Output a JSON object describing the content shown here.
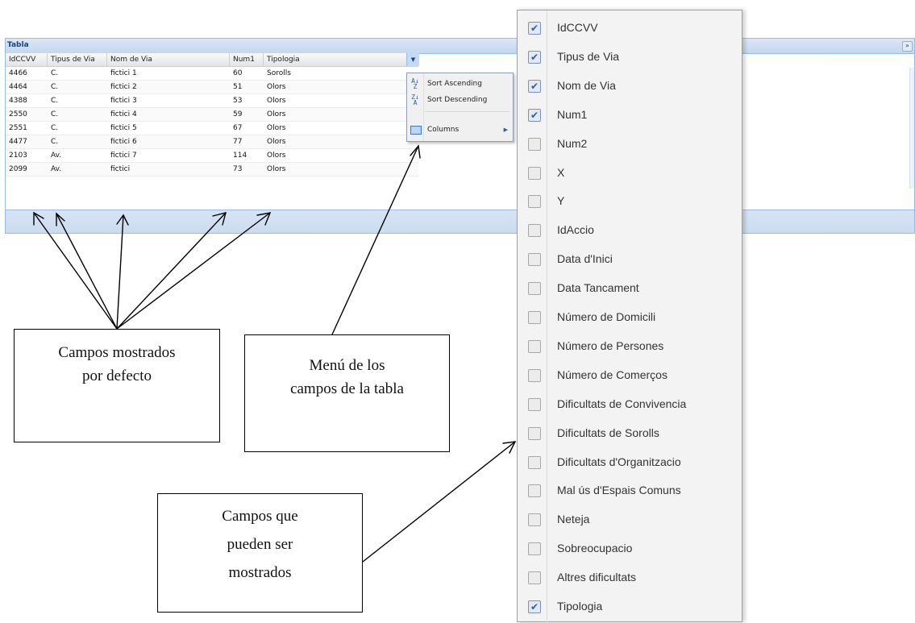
{
  "panel": {
    "title": "Tabla"
  },
  "grid": {
    "columns": [
      "IdCCVV",
      "Tipus de Via",
      "Nom de Via",
      "Num1",
      "Tipologia"
    ],
    "rows": [
      [
        "4466",
        "C.",
        "fictici 1",
        "60",
        "Sorolls"
      ],
      [
        "4464",
        "C.",
        "fictici 2",
        "51",
        "Olors"
      ],
      [
        "4388",
        "C.",
        "fictici 3",
        "53",
        "Olors"
      ],
      [
        "2550",
        "C.",
        "fictici 4",
        "59",
        "Olors"
      ],
      [
        "2551",
        "C.",
        "fictici 5",
        "67",
        "Olors"
      ],
      [
        "4477",
        "C.",
        "fictici 6",
        "77",
        "Olors"
      ],
      [
        "2103",
        "Av.",
        "fictici 7",
        "114",
        "Olors"
      ],
      [
        "2099",
        "Av.",
        "fictici",
        "73",
        "Olors"
      ]
    ]
  },
  "header_menu": {
    "sort_ascending": "Sort Ascending",
    "sort_descending": "Sort Descending",
    "columns": "Columns"
  },
  "columns_menu": {
    "items": [
      {
        "label": "IdCCVV",
        "checked": true
      },
      {
        "label": "Tipus de Via",
        "checked": true
      },
      {
        "label": "Nom de Via",
        "checked": true
      },
      {
        "label": "Num1",
        "checked": true
      },
      {
        "label": "Num2",
        "checked": false
      },
      {
        "label": "X",
        "checked": false
      },
      {
        "label": "Y",
        "checked": false
      },
      {
        "label": "IdAccio",
        "checked": false
      },
      {
        "label": "Data d'Inici",
        "checked": false
      },
      {
        "label": "Data Tancament",
        "checked": false
      },
      {
        "label": "Número de Domicili",
        "checked": false
      },
      {
        "label": "Número de Persones",
        "checked": false
      },
      {
        "label": "Número de Comerços",
        "checked": false
      },
      {
        "label": "Dificultats de Convivencia",
        "checked": false
      },
      {
        "label": "Dificultats de Sorolls",
        "checked": false
      },
      {
        "label": "Dificultats d'Organitzacio",
        "checked": false
      },
      {
        "label": "Mal ús d'Espais Comuns",
        "checked": false
      },
      {
        "label": "Neteja",
        "checked": false
      },
      {
        "label": "Sobreocupacio",
        "checked": false
      },
      {
        "label": "Altres dificultats",
        "checked": false
      },
      {
        "label": "Tipologia",
        "checked": true
      }
    ]
  },
  "annotations": {
    "default_fields": [
      "Campos mostrados",
      "por defecto"
    ],
    "fields_menu": [
      "Menú de los",
      "campos de la tabla"
    ],
    "available_fields": [
      "Campos que",
      "pueden ser",
      "mostrados"
    ]
  }
}
